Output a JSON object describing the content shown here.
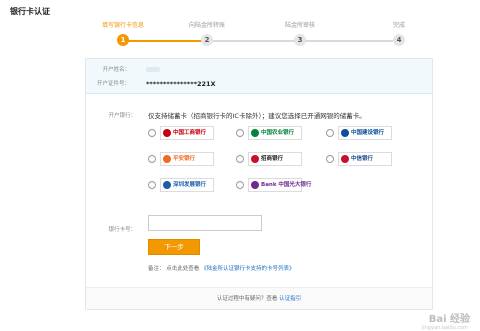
{
  "page": {
    "title": "银行卡认证"
  },
  "steps": [
    {
      "label": "填写银行卡信息",
      "num": "1",
      "state": "done"
    },
    {
      "label": "向陆金所转账",
      "num": "2",
      "state": "todo"
    },
    {
      "label": "陆金所审核",
      "num": "3",
      "state": "todo"
    },
    {
      "label": "完成",
      "num": "4",
      "state": "todo"
    }
  ],
  "info": {
    "name_label": "开户姓名：",
    "name_value": "",
    "id_label": "开户证件号：",
    "id_value": "***************221X"
  },
  "bank": {
    "label": "开户银行：",
    "tip": "仅支持储蓄卡（招商银行卡的IC卡除外）；建议您选择已开通网银的储蓄卡。",
    "options": [
      {
        "name": "中国工商银行",
        "color": "#c7000b",
        "text_color": "#c7000b"
      },
      {
        "name": "中国农业银行",
        "color": "#00833d",
        "text_color": "#00833d"
      },
      {
        "name": "中国建设银行",
        "color": "#0b4f9a",
        "text_color": "#0b4f9a"
      },
      {
        "name": "平安银行",
        "color": "#f26a21",
        "text_color": "#f26a21"
      },
      {
        "name": "招商银行",
        "color": "#c8102e",
        "text_color": "#222222"
      },
      {
        "name": "中信银行",
        "color": "#c8102e",
        "text_color": "#1c4a8f"
      },
      {
        "name": "深圳发展银行",
        "color": "#1b5faa",
        "text_color": "#1b5faa"
      },
      {
        "name": "Bank 中国光大银行",
        "color": "#6d2b8f",
        "text_color": "#6d2b8f"
      }
    ]
  },
  "card": {
    "label": "银行卡号：",
    "value": ""
  },
  "next_button": "下一步",
  "note": {
    "prefix": "备注：",
    "text": "点击此处查看",
    "link": "《陆金所认证银行卡支持的卡号列表》"
  },
  "footer": {
    "text": "认证过程中有疑问？查看",
    "link": "认证指引"
  },
  "watermark": {
    "main": "Bai 经验",
    "sub": "jingyan.baidu.com"
  }
}
